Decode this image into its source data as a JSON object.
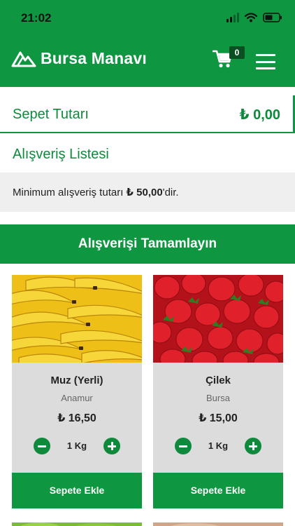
{
  "status_bar": {
    "time": "21:02"
  },
  "header": {
    "app_name": "Bursa Manavı",
    "cart_count": "0"
  },
  "cart_total": {
    "label": "Sepet Tutarı",
    "value": "₺ 0,00"
  },
  "shopping_list": {
    "title": "Alışveriş Listesi"
  },
  "min_notice": {
    "prefix": "Minimum alışveriş tutarı",
    "amount": "₺ 50,00",
    "suffix": "'dir."
  },
  "complete_button": {
    "label": "Alışverişi Tamamlayın"
  },
  "products": [
    {
      "name": "Muz (Yerli)",
      "origin": "Anamur",
      "price": "₺ 16,50",
      "quantity": "1 Kg",
      "add_label": "Sepete Ekle"
    },
    {
      "name": "Çilek",
      "origin": "Bursa",
      "price": "₺ 15,00",
      "quantity": "1 Kg",
      "add_label": "Sepete Ekle"
    }
  ],
  "colors": {
    "brand_green": "#0f9640",
    "text_green": "#0f8a3c",
    "badge_dark": "#0a4e22",
    "card_bg": "#dcdcdc",
    "notice_bg": "#efefef"
  },
  "icons": [
    "signal-icon",
    "wifi-icon",
    "battery-icon",
    "logo-mountain-icon",
    "cart-icon",
    "hamburger-menu-icon",
    "minus-icon",
    "plus-icon"
  ]
}
